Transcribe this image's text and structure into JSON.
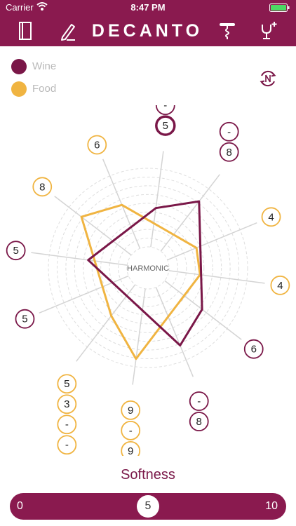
{
  "status_bar": {
    "carrier": "Carrier",
    "time": "8:47 PM",
    "wifi_icon": "wifi-icon",
    "battery_icon": "battery-icon"
  },
  "navbar": {
    "brand": "DECANTO",
    "icons": [
      "notebook-icon",
      "pencil-icon",
      "corkscrew-icon",
      "add-glass-icon"
    ]
  },
  "legend": [
    {
      "label": "Wine",
      "color": "#7a1748"
    },
    {
      "label": "Food",
      "color": "#f0b441"
    }
  ],
  "reset_icon": "swap-icon",
  "radar": {
    "center_label": "HARMONIC",
    "wine_color": "#7a1748",
    "food_color": "#f0b441",
    "max": 10,
    "axes": [
      {
        "badges": [
          {
            "kind": "wine",
            "value": "-"
          },
          {
            "kind": "wine",
            "value": "5",
            "selected": true
          }
        ]
      },
      {
        "badges": [
          {
            "kind": "wine",
            "value": "-"
          },
          {
            "kind": "wine",
            "value": "8"
          }
        ]
      },
      {
        "badges": [
          {
            "kind": "food",
            "value": "4"
          }
        ]
      },
      {
        "badges": [
          {
            "kind": "food",
            "value": "4"
          }
        ]
      },
      {
        "badges": [
          {
            "kind": "wine",
            "value": "6"
          }
        ]
      },
      {
        "badges": [
          {
            "kind": "wine",
            "value": "-"
          },
          {
            "kind": "wine",
            "value": "8"
          }
        ]
      },
      {
        "badges": [
          {
            "kind": "food",
            "value": "9"
          },
          {
            "kind": "food",
            "value": "-"
          },
          {
            "kind": "food",
            "value": "9"
          }
        ]
      },
      {
        "badges": [
          {
            "kind": "food",
            "value": "5"
          },
          {
            "kind": "food",
            "value": "3"
          },
          {
            "kind": "food",
            "value": "-"
          },
          {
            "kind": "food",
            "value": "-"
          }
        ]
      },
      {
        "badges": [
          {
            "kind": "wine",
            "value": "5"
          }
        ]
      },
      {
        "badges": [
          {
            "kind": "wine",
            "value": "5"
          }
        ]
      },
      {
        "badges": [
          {
            "kind": "food",
            "value": "8"
          }
        ]
      },
      {
        "badges": [
          {
            "kind": "food",
            "value": "6"
          }
        ]
      }
    ],
    "wine_values": [
      5,
      8,
      0,
      0,
      6,
      8,
      0,
      0,
      0,
      5,
      0,
      0
    ],
    "food_values": [
      0,
      0,
      4,
      4,
      0,
      0,
      9,
      5,
      0,
      0,
      8,
      6
    ]
  },
  "attribute": {
    "title": "Softness",
    "min": "0",
    "max": "10",
    "value": "5"
  }
}
